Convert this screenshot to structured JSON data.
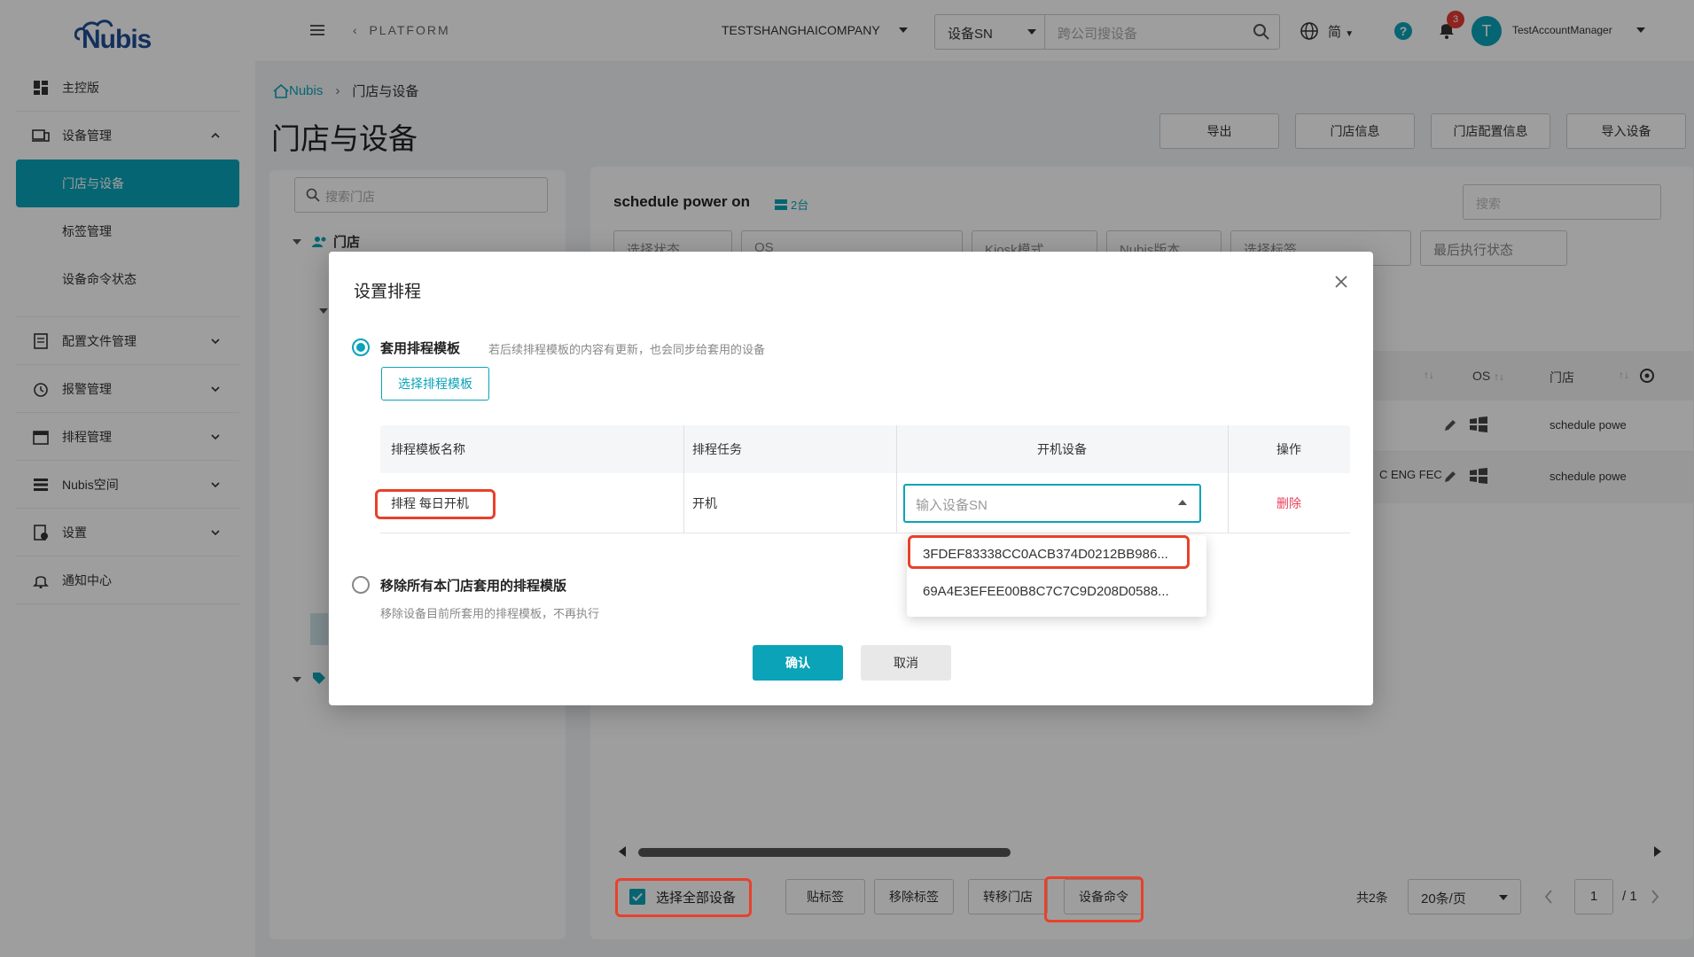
{
  "app": {
    "logo_text": "Nubis"
  },
  "sidebar": {
    "items": [
      {
        "label": "主控版",
        "icon": "dashboard-icon"
      },
      {
        "label": "设备管理",
        "icon": "devices-icon",
        "expanded": true,
        "children": [
          {
            "label": "门店与设备",
            "active": true
          },
          {
            "label": "标签管理"
          },
          {
            "label": "设备命令状态"
          }
        ]
      },
      {
        "label": "配置文件管理",
        "icon": "file-config-icon"
      },
      {
        "label": "报警管理",
        "icon": "alarm-icon"
      },
      {
        "label": "排程管理",
        "icon": "calendar-icon"
      },
      {
        "label": "Nubis空间",
        "icon": "storage-icon"
      },
      {
        "label": "设置",
        "icon": "settings-doc-icon"
      },
      {
        "label": "通知中心",
        "icon": "bell-icon"
      }
    ]
  },
  "topbar": {
    "back_label": "PLATFORM",
    "company": "TESTSHANGHAICOMPANY",
    "search_type": "设备SN",
    "search_placeholder": "跨公司搜设备",
    "language": "简",
    "notification_count": "3",
    "avatar_letter": "T",
    "username": "TestAccountManager"
  },
  "breadcrumb": {
    "home": "Nubis",
    "current": "门店与设备"
  },
  "page_title": "门店与设备",
  "top_buttons": [
    "导出",
    "门店信息",
    "门店配置信息",
    "导入设备"
  ],
  "left_panel": {
    "search_placeholder": "搜索门店",
    "root_label": "门店"
  },
  "right_panel": {
    "title": "schedule power on",
    "count": "2台",
    "search_placeholder": "搜索",
    "filters": [
      "选择状态",
      "OS",
      "Kiosk模式",
      "Nubis版本",
      "选择标签",
      "最后执行状态"
    ],
    "columns": {
      "os": "OS",
      "store": "门店"
    },
    "rows": [
      {
        "store": "schedule powe",
        "partial_text": ""
      },
      {
        "store": "schedule powe",
        "partial_text": "C ENG FEC"
      }
    ],
    "bottom": {
      "select_all": "选择全部设备",
      "buttons": [
        "贴标签",
        "移除标签",
        "转移门店",
        "设备命令"
      ],
      "total": "共2条",
      "page_size": "20条/页",
      "page": "1",
      "page_total": "/ 1"
    }
  },
  "modal": {
    "title": "设置排程",
    "option1": {
      "label": "套用排程模板",
      "hint": "若后续排程模板的内容有更新，也会同步给套用的设备",
      "selected": true
    },
    "choose_template": "选择排程模板",
    "table": {
      "headers": [
        "排程模板名称",
        "排程任务",
        "开机设备",
        "操作"
      ],
      "row": {
        "name": "排程 每日开机",
        "task": "开机",
        "sn_placeholder": "输入设备SN",
        "action": "删除"
      }
    },
    "dropdown_options": [
      "3FDEF83338CC0ACB374D0212BB986...",
      "69A4E3EFEE00B8C7C7C9D208D0588..."
    ],
    "option2": {
      "label": "移除所有本门店套用的排程模版",
      "hint": "移除设备目前所套用的排程模板，不再执行",
      "selected": false
    },
    "confirm": "确认",
    "cancel": "取消"
  },
  "colors": {
    "accent": "#0aa3b8",
    "highlight": "#e8412c",
    "delete": "#e8415a",
    "badge": "#e53935"
  }
}
